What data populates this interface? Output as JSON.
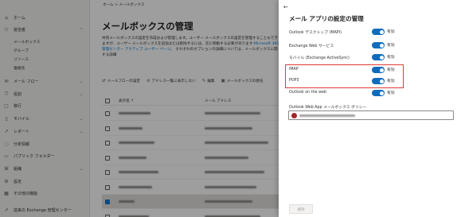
{
  "nav": {
    "items": [
      {
        "label": "ホーム",
        "icon": "home-icon",
        "glyph": "⌂"
      },
      {
        "label": "受信者",
        "icon": "person-icon",
        "glyph": "⚇",
        "expanded": true
      },
      {
        "label": "メール フロー",
        "icon": "mail-flow-icon",
        "glyph": "✉"
      },
      {
        "label": "役割",
        "icon": "roles-icon",
        "glyph": "⛉"
      },
      {
        "label": "移行",
        "icon": "migration-icon",
        "glyph": "▢"
      },
      {
        "label": "モバイル",
        "icon": "mobile-icon",
        "glyph": "▯"
      },
      {
        "label": "レポート",
        "icon": "reports-icon",
        "glyph": "↗"
      },
      {
        "label": "分析情報",
        "icon": "insights-icon",
        "glyph": "◌"
      },
      {
        "label": "パブリック フォルダー",
        "icon": "folder-icon",
        "glyph": "▭"
      },
      {
        "label": "組織",
        "icon": "organization-icon",
        "glyph": "⌘"
      },
      {
        "label": "設定",
        "icon": "settings-icon",
        "glyph": "⚙"
      },
      {
        "label": "その他の機能",
        "icon": "more-features-icon",
        "glyph": "▦"
      },
      {
        "label": "従来の Exchange 管理センター",
        "icon": "classic-eac-icon",
        "glyph": "↗"
      }
    ],
    "subitems": [
      "メールボックス",
      "グループ",
      "リソース",
      "連絡先"
    ]
  },
  "main": {
    "breadcrumb": "ホーム > メールボックス",
    "title": "メールボックスの管理",
    "description": "共有メールボックスの設定を作成および管理します。ユーザー メールボックスの設定を管理することもできますが、ユーザー メールボックスを追加または削除するには、次に移動する必要があります:",
    "description_link": "Microsoft 365 管理センター アクティブ ユーザー ページ",
    "description_tail": "。 それぞれのオプションの詳細については、メールボックスに関する詳細",
    "toolbar": [
      {
        "label": "メールフローの設定",
        "icon": "mail-flow-settings-icon",
        "glyph": "⇄"
      },
      {
        "label": "アドレス一覧に表示しない",
        "icon": "hide-icon",
        "glyph": "⊘"
      },
      {
        "label": "編集",
        "icon": "edit-icon",
        "glyph": "✎"
      },
      {
        "label": "メールボックスの委任",
        "icon": "delegation-icon",
        "glyph": "▣"
      }
    ],
    "columns": {
      "name": "表示名 ↑",
      "email": "メール アドレス"
    },
    "rows": [
      {
        "name_w": 40,
        "mail_w": 70,
        "selected": false
      },
      {
        "name_w": 30,
        "mail_w": 60,
        "selected": false
      },
      {
        "name_w": 45,
        "mail_w": 80,
        "selected": false
      },
      {
        "name_w": 35,
        "mail_w": 55,
        "selected": false
      },
      {
        "name_w": 50,
        "mail_w": 75,
        "selected": false
      },
      {
        "name_w": 42,
        "mail_w": 65,
        "selected": false
      },
      {
        "name_w": 20,
        "mail_w": 60,
        "selected": true
      },
      {
        "name_w": 38,
        "mail_w": 70,
        "selected": false
      }
    ]
  },
  "panel": {
    "title": "メール アプリの設定の管理",
    "apps": [
      {
        "label": "Outlook デスクトップ (MAPI)",
        "state": "有効"
      },
      {
        "label": "Exchange Web サービス",
        "state": "有効"
      },
      {
        "label": "モバイル (Exchange ActiveSync)",
        "state": "有効"
      },
      {
        "label": "IMAP",
        "state": "有効"
      },
      {
        "label": "POP3",
        "state": "有効"
      },
      {
        "label": "Outlook on the web",
        "state": "有効"
      }
    ],
    "policy_label": "Outlook Web App メールボックス ポリシー",
    "save_label": "保存",
    "colors": {
      "toggle_on": "#0f6cbd",
      "highlight": "#e03c31"
    }
  }
}
